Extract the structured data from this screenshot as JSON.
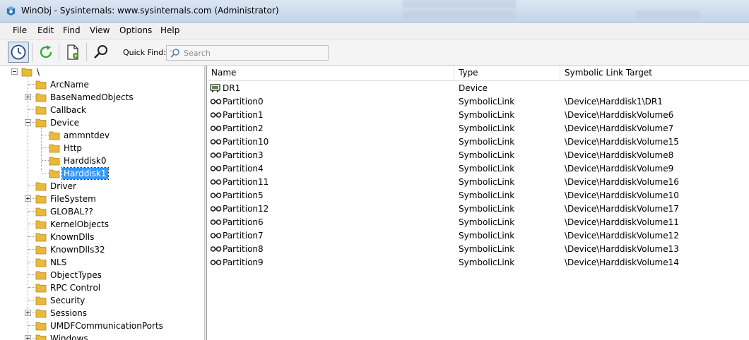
{
  "window": {
    "title": "WinObj - Sysinternals: www.sysinternals.com (Administrator)"
  },
  "menu": [
    "File",
    "Edit",
    "Find",
    "View",
    "Options",
    "Help"
  ],
  "toolbar": {
    "quick_find_label": "Quick Find:",
    "search_placeholder": "Search"
  },
  "tree": {
    "root": "\\",
    "nodes": [
      {
        "label": "ArcName",
        "level": 1,
        "expander": "none"
      },
      {
        "label": "BaseNamedObjects",
        "level": 1,
        "expander": "plus"
      },
      {
        "label": "Callback",
        "level": 1,
        "expander": "none"
      },
      {
        "label": "Device",
        "level": 1,
        "expander": "minus"
      },
      {
        "label": "ammntdev",
        "level": 2,
        "expander": "none"
      },
      {
        "label": "Http",
        "level": 2,
        "expander": "none"
      },
      {
        "label": "Harddisk0",
        "level": 2,
        "expander": "none"
      },
      {
        "label": "Harddisk1",
        "level": 2,
        "expander": "none",
        "selected": true
      },
      {
        "label": "Driver",
        "level": 1,
        "expander": "none"
      },
      {
        "label": "FileSystem",
        "level": 1,
        "expander": "plus"
      },
      {
        "label": "GLOBAL??",
        "level": 1,
        "expander": "none"
      },
      {
        "label": "KernelObjects",
        "level": 1,
        "expander": "none"
      },
      {
        "label": "KnownDlls",
        "level": 1,
        "expander": "none"
      },
      {
        "label": "KnownDlls32",
        "level": 1,
        "expander": "none"
      },
      {
        "label": "NLS",
        "level": 1,
        "expander": "none"
      },
      {
        "label": "ObjectTypes",
        "level": 1,
        "expander": "none"
      },
      {
        "label": "RPC Control",
        "level": 1,
        "expander": "none"
      },
      {
        "label": "Security",
        "level": 1,
        "expander": "none"
      },
      {
        "label": "Sessions",
        "level": 1,
        "expander": "plus"
      },
      {
        "label": "UMDFCommunicationPorts",
        "level": 1,
        "expander": "none"
      },
      {
        "label": "Windows",
        "level": 1,
        "expander": "plus"
      }
    ]
  },
  "list": {
    "columns": [
      "Name",
      "Type",
      "Symbolic Link Target"
    ],
    "rows": [
      {
        "name": "DR1",
        "type": "Device",
        "target": "",
        "icon": "device-icon"
      },
      {
        "name": "Partition0",
        "type": "SymbolicLink",
        "target": "\\Device\\Harddisk1\\DR1",
        "icon": "symlink-icon"
      },
      {
        "name": "Partition1",
        "type": "SymbolicLink",
        "target": "\\Device\\HarddiskVolume6",
        "icon": "symlink-icon"
      },
      {
        "name": "Partition2",
        "type": "SymbolicLink",
        "target": "\\Device\\HarddiskVolume7",
        "icon": "symlink-icon"
      },
      {
        "name": "Partition10",
        "type": "SymbolicLink",
        "target": "\\Device\\HarddiskVolume15",
        "icon": "symlink-icon"
      },
      {
        "name": "Partition3",
        "type": "SymbolicLink",
        "target": "\\Device\\HarddiskVolume8",
        "icon": "symlink-icon"
      },
      {
        "name": "Partition4",
        "type": "SymbolicLink",
        "target": "\\Device\\HarddiskVolume9",
        "icon": "symlink-icon"
      },
      {
        "name": "Partition11",
        "type": "SymbolicLink",
        "target": "\\Device\\HarddiskVolume16",
        "icon": "symlink-icon"
      },
      {
        "name": "Partition5",
        "type": "SymbolicLink",
        "target": "\\Device\\HarddiskVolume10",
        "icon": "symlink-icon"
      },
      {
        "name": "Partition12",
        "type": "SymbolicLink",
        "target": "\\Device\\HarddiskVolume17",
        "icon": "symlink-icon"
      },
      {
        "name": "Partition6",
        "type": "SymbolicLink",
        "target": "\\Device\\HarddiskVolume11",
        "icon": "symlink-icon"
      },
      {
        "name": "Partition7",
        "type": "SymbolicLink",
        "target": "\\Device\\HarddiskVolume12",
        "icon": "symlink-icon"
      },
      {
        "name": "Partition8",
        "type": "SymbolicLink",
        "target": "\\Device\\HarddiskVolume13",
        "icon": "symlink-icon"
      },
      {
        "name": "Partition9",
        "type": "SymbolicLink",
        "target": "\\Device\\HarddiskVolume14",
        "icon": "symlink-icon"
      }
    ]
  },
  "colors": {
    "selection": "#3399ff",
    "folder": "#e8b93a",
    "titlebar": "#c9d8ec"
  }
}
